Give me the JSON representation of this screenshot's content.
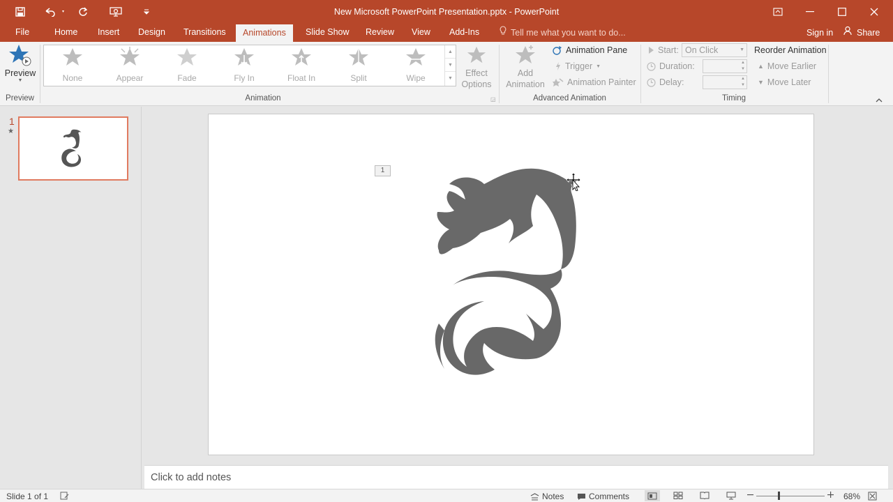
{
  "window": {
    "title": "New Microsoft PowerPoint Presentation.pptx - PowerPoint",
    "accent": "#b7472a"
  },
  "qat": {
    "icons": [
      "save-icon",
      "undo-icon",
      "redo-icon",
      "present-from-start-icon",
      "customize-qat-icon"
    ]
  },
  "tabs": [
    {
      "label": "File"
    },
    {
      "label": "Home"
    },
    {
      "label": "Insert"
    },
    {
      "label": "Design"
    },
    {
      "label": "Transitions"
    },
    {
      "label": "Animations",
      "active": true
    },
    {
      "label": "Slide Show"
    },
    {
      "label": "Review"
    },
    {
      "label": "View"
    },
    {
      "label": "Add-Ins"
    }
  ],
  "tell_me": {
    "placeholder": "Tell me what you want to do..."
  },
  "account": {
    "sign_in": "Sign in",
    "share": "Share"
  },
  "ribbon": {
    "preview": {
      "label": "Preview",
      "group": "Preview"
    },
    "animation_gallery": {
      "group": "Animation",
      "items": [
        "None",
        "Appear",
        "Fade",
        "Fly In",
        "Float In",
        "Split",
        "Wipe"
      ],
      "effect_options": [
        "Effect",
        "Options"
      ]
    },
    "advanced": {
      "group": "Advanced Animation",
      "add_animation": [
        "Add",
        "Animation"
      ],
      "animation_pane": "Animation Pane",
      "trigger": "Trigger",
      "animation_painter": "Animation Painter"
    },
    "timing": {
      "group": "Timing",
      "start_label": "Start:",
      "start_value": "On Click",
      "duration_label": "Duration:",
      "delay_label": "Delay:",
      "reorder": "Reorder Animation",
      "move_earlier": "Move Earlier",
      "move_later": "Move Later"
    }
  },
  "slides_panel": {
    "slide_number": "1"
  },
  "slide": {
    "animation_tag": "1"
  },
  "notes": {
    "placeholder": "Click to add notes"
  },
  "status": {
    "slide_info": "Slide 1 of 1",
    "notes": "Notes",
    "comments": "Comments",
    "zoom": "68%",
    "zoom_fraction": 0.68
  }
}
